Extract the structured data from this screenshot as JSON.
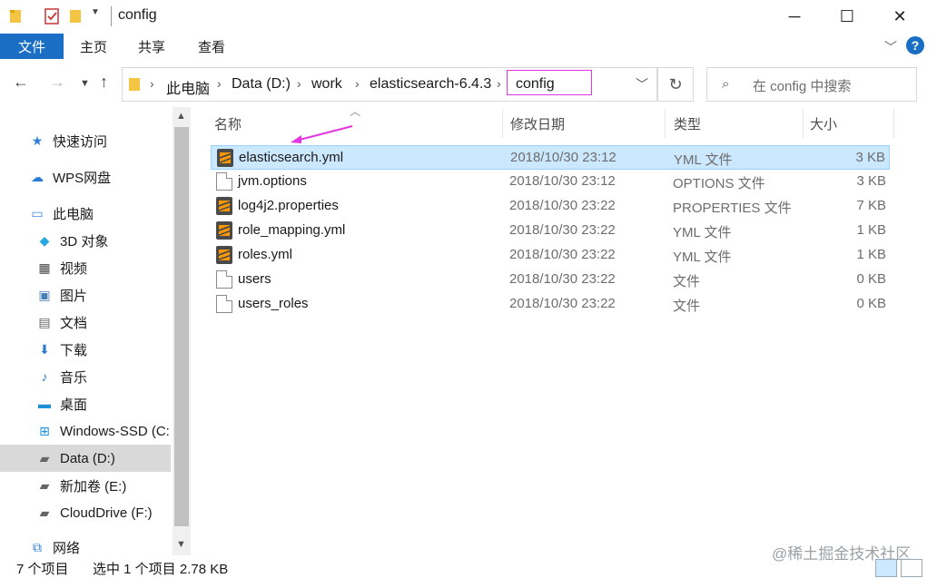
{
  "window": {
    "title": "config"
  },
  "ribbon": {
    "file": "文件",
    "tabs": [
      "主页",
      "共享",
      "查看"
    ],
    "help": "?"
  },
  "address": {
    "crumbs": [
      "此电脑",
      "Data (D:)",
      "work",
      "elasticsearch-6.4.3",
      "config"
    ],
    "search_placeholder": "在 config 中搜索"
  },
  "nav": {
    "items": [
      {
        "label": "快速访问",
        "icon": "star-icon"
      },
      {
        "label": "WPS网盘",
        "icon": "cloud-icon"
      },
      {
        "label": "此电脑",
        "icon": "computer-icon"
      },
      {
        "label": "3D 对象",
        "icon": "cube-icon"
      },
      {
        "label": "视频",
        "icon": "film-icon"
      },
      {
        "label": "图片",
        "icon": "picture-icon"
      },
      {
        "label": "文档",
        "icon": "document-icon"
      },
      {
        "label": "下载",
        "icon": "download-icon"
      },
      {
        "label": "音乐",
        "icon": "music-icon"
      },
      {
        "label": "桌面",
        "icon": "desktop-icon"
      },
      {
        "label": "Windows-SSD (C:",
        "icon": "windows-drive-icon"
      },
      {
        "label": "Data (D:)",
        "icon": "drive-icon",
        "selected": true
      },
      {
        "label": "新加卷 (E:)",
        "icon": "drive-icon"
      },
      {
        "label": "CloudDrive (F:)",
        "icon": "drive-icon"
      },
      {
        "label": "网络",
        "icon": "network-icon"
      }
    ]
  },
  "columns": {
    "name": "名称",
    "modified": "修改日期",
    "type": "类型",
    "size": "大小"
  },
  "files": [
    {
      "name": "elasticsearch.yml",
      "modified": "2018/10/30 23:12",
      "type": "YML 文件",
      "size": "3 KB",
      "icon": "sublime-icon",
      "selected": true
    },
    {
      "name": "jvm.options",
      "modified": "2018/10/30 23:12",
      "type": "OPTIONS 文件",
      "size": "3 KB",
      "icon": "blank-file-icon"
    },
    {
      "name": "log4j2.properties",
      "modified": "2018/10/30 23:22",
      "type": "PROPERTIES 文件",
      "size": "7 KB",
      "icon": "sublime-icon"
    },
    {
      "name": "role_mapping.yml",
      "modified": "2018/10/30 23:22",
      "type": "YML 文件",
      "size": "1 KB",
      "icon": "sublime-icon"
    },
    {
      "name": "roles.yml",
      "modified": "2018/10/30 23:22",
      "type": "YML 文件",
      "size": "1 KB",
      "icon": "sublime-icon"
    },
    {
      "name": "users",
      "modified": "2018/10/30 23:22",
      "type": "文件",
      "size": "0 KB",
      "icon": "blank-file-icon"
    },
    {
      "name": "users_roles",
      "modified": "2018/10/30 23:22",
      "type": "文件",
      "size": "0 KB",
      "icon": "blank-file-icon"
    }
  ],
  "status": {
    "count": "7 个项目",
    "selection": "选中 1 个项目  2.78 KB"
  },
  "watermark": "@稀土掘金技术社区",
  "colors": {
    "accent": "#1a6fc4",
    "highlight": "#e236e2",
    "selection": "#cce8ff"
  }
}
